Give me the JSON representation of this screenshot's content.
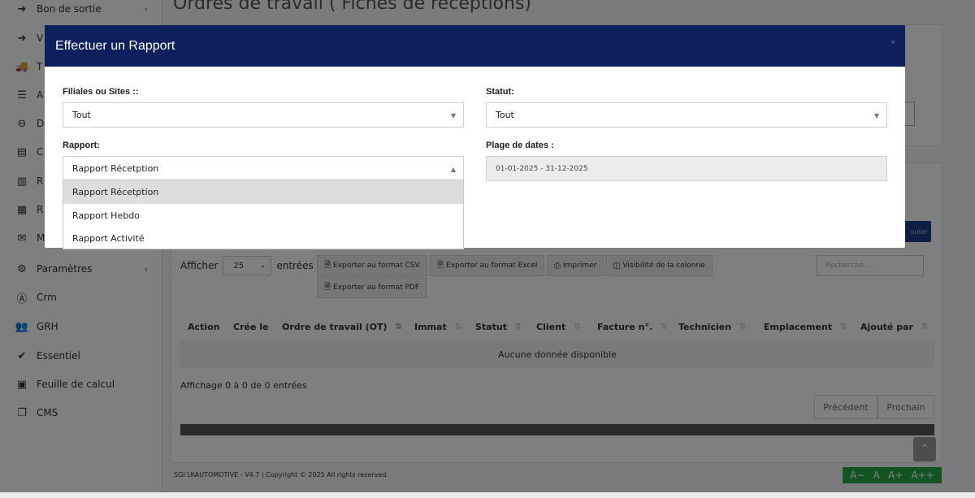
{
  "sidebar": {
    "items": [
      {
        "label": "Bon de sortie",
        "icon": "arrow-circle-icon",
        "chevron": "‹"
      },
      {
        "label": "V",
        "icon": "arrow-circle-icon"
      },
      {
        "label": "T",
        "icon": "truck-icon"
      },
      {
        "label": "A",
        "icon": "database-icon"
      },
      {
        "label": "D",
        "icon": "minus-circle-icon"
      },
      {
        "label": "C",
        "icon": "id-card-icon"
      },
      {
        "label": "R",
        "icon": "bar-chart-icon"
      },
      {
        "label": "R",
        "icon": "calendar-icon"
      },
      {
        "label": "M",
        "icon": "envelope-icon"
      },
      {
        "label": "Paramètres",
        "icon": "gear-icon",
        "chevron": "‹"
      },
      {
        "label": "Crm",
        "icon": "broadcast-icon"
      },
      {
        "label": "GRH",
        "icon": "users-icon"
      },
      {
        "label": "Essentiel",
        "icon": "check-circle-icon"
      },
      {
        "label": "Feuille de calcul",
        "icon": "excel-file-icon"
      },
      {
        "label": "CMS",
        "icon": "copy-icon"
      }
    ]
  },
  "page": {
    "title": "Ordres de travail ( Fiches de réceptions)"
  },
  "table_controls": {
    "show_label": "Afficher",
    "page_length": "25",
    "entries_label": "entrées",
    "export_csv": "Exporter au format CSV",
    "export_excel": "Exporter au format Excel",
    "print": "Imprimer",
    "column_visibility": "Visibilité de la colonne",
    "export_pdf": "Exporter au format PDF",
    "search_placeholder": "Recherche ..."
  },
  "table": {
    "columns": [
      "Action",
      "Crée le",
      "Ordre de travail (OT)",
      "Immat",
      "Statut",
      "Client",
      "Facture n°.",
      "Technicien",
      "Emplacement",
      "Ajouté par"
    ],
    "empty_message": "Aucune donnée disponible",
    "info": "Affichage 0 à 0 de 0 entrées",
    "prev": "Précédent",
    "next": "Prochain"
  },
  "footer": {
    "text": "SGI LKAUTOMOTIVE - V4.7 | Copyright © 2025 All rights reserved."
  },
  "font_tools": [
    "A−",
    "A",
    "A+",
    "A++"
  ],
  "background_button_label": "outer",
  "modal": {
    "title": "Effectuer un Rapport",
    "close": "×",
    "filiales_label": "Filiales ou Sites ::",
    "filiales_value": "Tout",
    "statut_label": "Statut:",
    "statut_value": "Tout",
    "rapport_label": "Rapport:",
    "rapport_value": "Rapport Récetption",
    "dates_label": "Plage de dates :",
    "dates_value": "01-01-2025 - 31-12-2025",
    "rapport_options": [
      "Rapport Récetption",
      "Rapport Hebdo",
      "Rapport Activité"
    ]
  }
}
